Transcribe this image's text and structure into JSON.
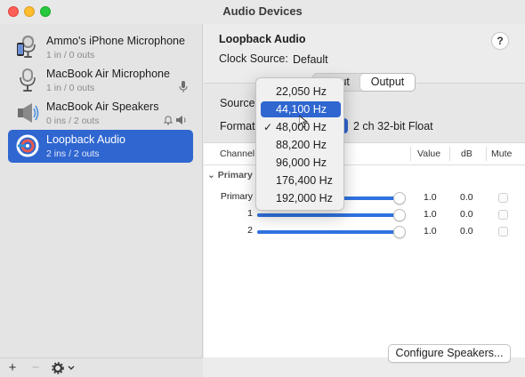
{
  "window": {
    "title": "Audio Devices"
  },
  "sidebar": {
    "devices": [
      {
        "name": "Ammo's iPhone Microphone",
        "io": "1 in / 0 outs",
        "icon": "iphone-microphone-icon",
        "selected": false
      },
      {
        "name": "MacBook Air Microphone",
        "io": "1 in / 0 outs",
        "icon": "microphone-icon",
        "selected": false
      },
      {
        "name": "MacBook Air Speakers",
        "io": "0 ins / 2 outs",
        "icon": "speaker-icon",
        "selected": false
      },
      {
        "name": "Loopback Audio",
        "io": "2 ins / 2 outs",
        "icon": "loopback-icon",
        "selected": true
      }
    ],
    "footer": {
      "add": "+",
      "remove": "−",
      "settings_icon": "gear-icon",
      "chevron": "chevron-down-icon"
    }
  },
  "main": {
    "device_title": "Loopback Audio",
    "help": "?",
    "clock_source_label": "Clock Source:",
    "clock_source_value": "Default",
    "tabs": [
      {
        "label": "Input",
        "active": false
      },
      {
        "label": "Output",
        "active": true
      }
    ],
    "source_label": "Source",
    "format_label": "Format",
    "format_value": "2 ch 32-bit Float",
    "table": {
      "headers": {
        "channel": "Channel",
        "value": "Value",
        "db": "dB",
        "mute": "Mute"
      },
      "group": "Primary S",
      "rows": [
        {
          "name": "Primary",
          "value": "1.0",
          "db": "0.0",
          "level": 1.0
        },
        {
          "name": "1",
          "value": "1.0",
          "db": "0.0",
          "level": 1.0
        },
        {
          "name": "2",
          "value": "1.0",
          "db": "0.0",
          "level": 1.0
        }
      ]
    },
    "configure_button": "Configure Speakers..."
  },
  "popup": {
    "items": [
      {
        "label": "22,050 Hz",
        "checked": false,
        "highlighted": false
      },
      {
        "label": "44,100 Hz",
        "checked": false,
        "highlighted": true
      },
      {
        "label": "48,000 Hz",
        "checked": true,
        "highlighted": false
      },
      {
        "label": "88,200 Hz",
        "checked": false,
        "highlighted": false
      },
      {
        "label": "96,000 Hz",
        "checked": false,
        "highlighted": false
      },
      {
        "label": "176,400 Hz",
        "checked": false,
        "highlighted": false
      },
      {
        "label": "192,000 Hz",
        "checked": false,
        "highlighted": false
      }
    ],
    "check_mark": "✓"
  },
  "colors": {
    "accent": "#2f66d0",
    "slider": "#2f72e0"
  }
}
